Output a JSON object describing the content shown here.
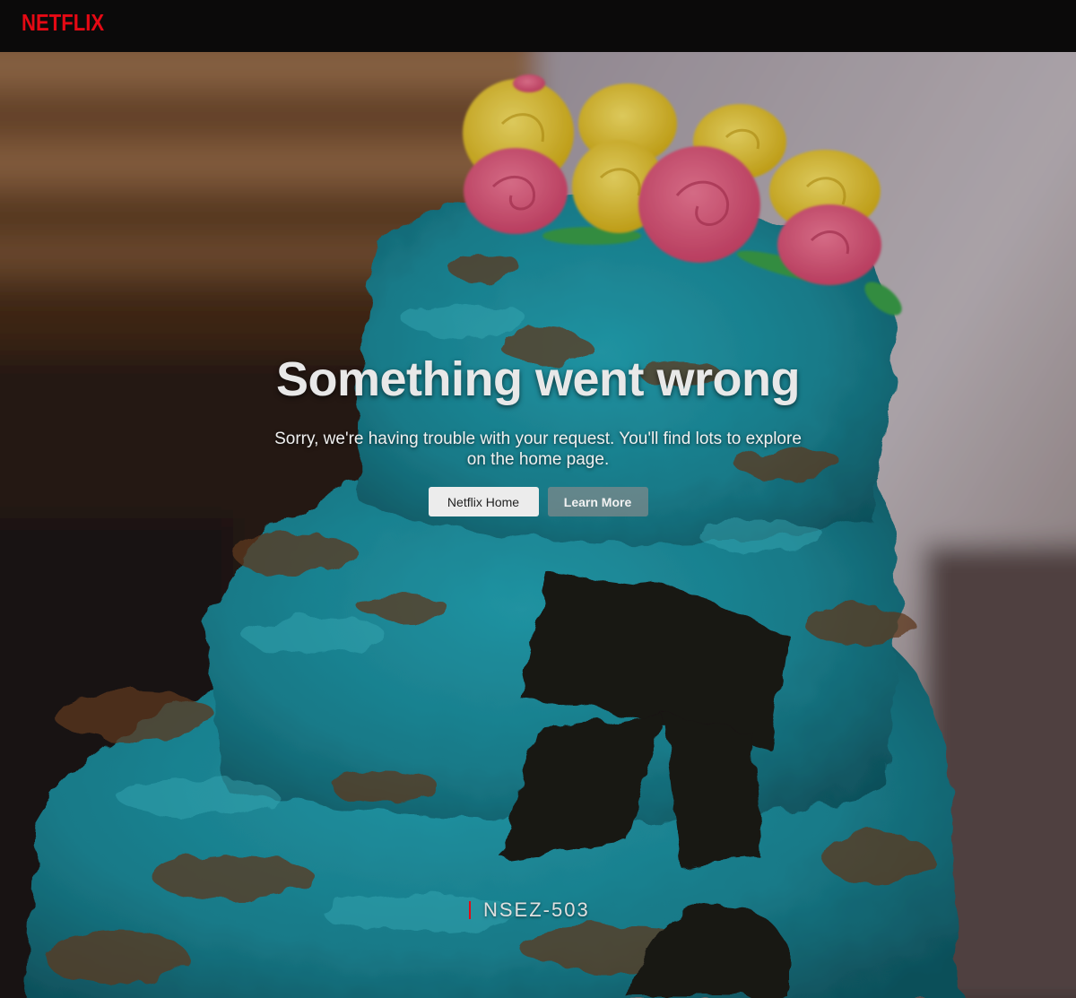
{
  "header": {
    "logo_text": "NETFLIX",
    "logo_color": "#e50914"
  },
  "error": {
    "title": "Something went wrong",
    "message": "Sorry, we're having trouble with your request. You'll find lots to explore on the home page.",
    "primary_button": "Netflix Home",
    "secondary_button": "Learn More",
    "code": "NSEZ-503"
  },
  "colors": {
    "accent": "#e50914",
    "frosting": "#1e8fa0",
    "background": "#0b0a0a"
  }
}
